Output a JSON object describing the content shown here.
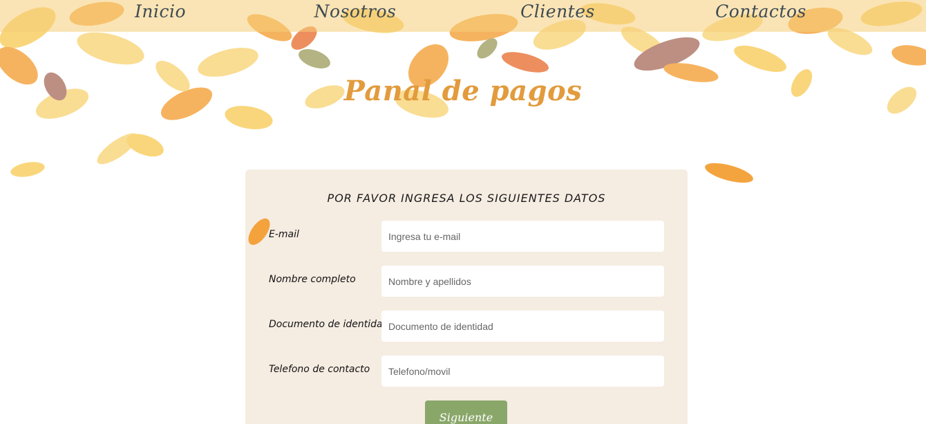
{
  "nav": {
    "items": [
      {
        "label": "Inicio"
      },
      {
        "label": "Nosotros"
      },
      {
        "label": "Clientes"
      },
      {
        "label": "Contactos"
      }
    ]
  },
  "page": {
    "title": "Panal de pagos"
  },
  "form": {
    "heading": "POR FAVOR INGRESA LOS SIGUIENTES DATOS",
    "fields": [
      {
        "label": "E-mail",
        "placeholder": "Ingresa tu e-mail",
        "value": ""
      },
      {
        "label": "Nombre completo",
        "placeholder": "Nombre y apellidos",
        "value": ""
      },
      {
        "label": "Documento de identidad",
        "placeholder": "Documento de identidad",
        "value": ""
      },
      {
        "label": "Telefono de contacto",
        "placeholder": "Telefono/movil",
        "value": ""
      }
    ],
    "submit_label": "Siguiente"
  },
  "colors": {
    "title": "#e29b3d",
    "panel_bg": "#f5ece2",
    "button_bg": "#8aa76a",
    "nav_text": "#3e4a52",
    "leaf_orange": "#f39a2a",
    "leaf_yellow": "#f8d270"
  }
}
